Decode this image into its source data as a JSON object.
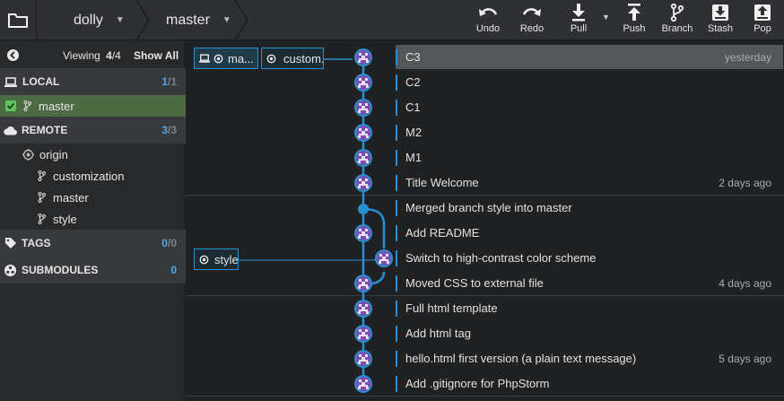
{
  "toolbar": {
    "repo": "dolly",
    "branch": "master",
    "buttons": [
      {
        "label": "Undo"
      },
      {
        "label": "Redo"
      },
      {
        "label": "Pull"
      },
      {
        "label": "Push"
      },
      {
        "label": "Branch"
      },
      {
        "label": "Stash"
      },
      {
        "label": "Pop"
      }
    ]
  },
  "sidebar": {
    "viewing_prefix": "Viewing",
    "viewing_count": "4",
    "viewing_total": "/4",
    "show_all": "Show All",
    "local": {
      "title": "LOCAL",
      "count": "1",
      "total": "/1",
      "branches": [
        "master"
      ]
    },
    "remote": {
      "title": "REMOTE",
      "count": "3",
      "total": "/3",
      "origin": "origin",
      "branches": [
        "customization",
        "master",
        "style"
      ]
    },
    "tags": {
      "title": "TAGS",
      "count": "0",
      "total": "/0"
    },
    "submodules": {
      "title": "SUBMODULES",
      "count": "0"
    }
  },
  "refs": {
    "master_short": "ma...",
    "customization_short": "custom...",
    "style": "style"
  },
  "commits": [
    {
      "message": "C3",
      "date": "yesterday"
    },
    {
      "message": "C2",
      "date": ""
    },
    {
      "message": "C1",
      "date": ""
    },
    {
      "message": "M2",
      "date": ""
    },
    {
      "message": "M1",
      "date": ""
    },
    {
      "message": "Title Welcome",
      "date": "2 days ago"
    },
    {
      "message": "Merged branch style into master",
      "date": ""
    },
    {
      "message": "Add README",
      "date": ""
    },
    {
      "message": "Switch to high-contrast color scheme",
      "date": ""
    },
    {
      "message": "Moved CSS to external file",
      "date": "4 days ago"
    },
    {
      "message": "Full html template",
      "date": ""
    },
    {
      "message": "Add html tag",
      "date": ""
    },
    {
      "message": "hello.html first version (a plain text message)",
      "date": "5 days ago"
    },
    {
      "message": "Add .gitignore for PhpStorm",
      "date": ""
    }
  ],
  "colors": {
    "accent": "#2a8fd0",
    "avatar": "#7b4fb0",
    "active_branch": "#4c6b43"
  }
}
